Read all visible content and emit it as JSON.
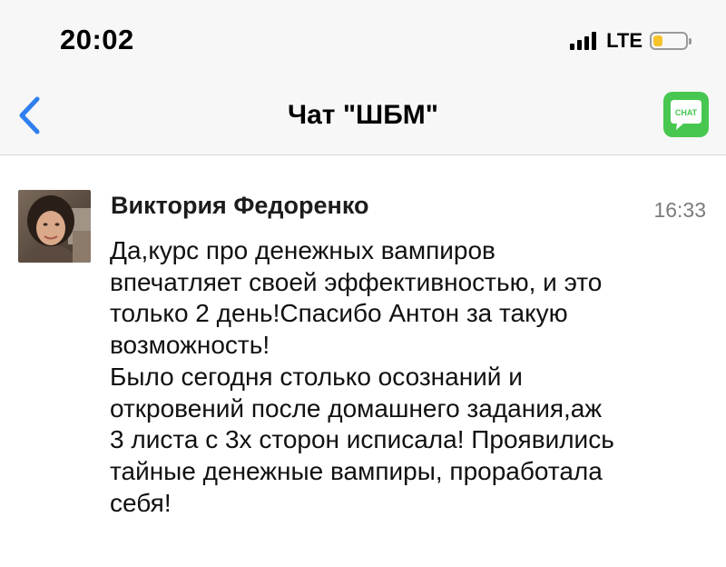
{
  "status_bar": {
    "time": "20:02",
    "network": "LTE",
    "battery_level": 0.3,
    "battery_color": "#f5c32c"
  },
  "nav_bar": {
    "back_icon": "chevron-left-icon",
    "title": "Чат \"ШБМ\"",
    "chat_button_label": "CHAT",
    "accent_color": "#2f7ff0",
    "chat_button_color": "#47c750"
  },
  "message": {
    "sender": "Виктория Федоренко",
    "time": "16:33",
    "text": "Да,курс про денежных вампиров\nвпечатляет своей эффективностью, и это\nтолько 2 день!Спасибо Антон за такую\nвозможность!\nБыло сегодня столько осознаний и\nоткровений после домашнего задания,аж\n3 листа с 3х сторон исписала! Проявились\nтайные денежные вампиры, проработала\nсебя!"
  }
}
